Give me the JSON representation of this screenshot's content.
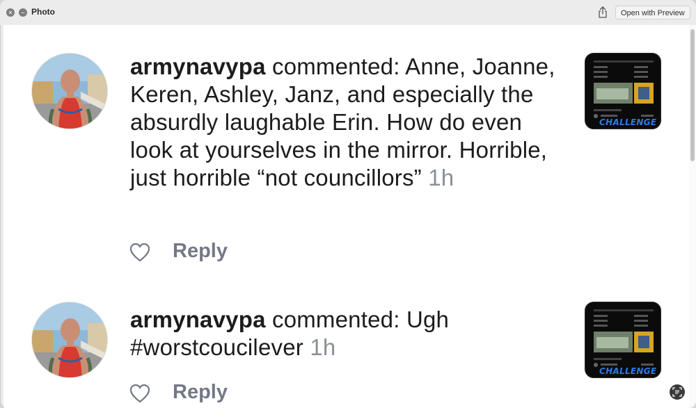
{
  "window": {
    "title": "Photo",
    "open_with_label": "Open with Preview",
    "close_glyph": "×",
    "minimize_glyph": "–",
    "share_icon": "share-icon"
  },
  "comments": [
    {
      "username": "armynavypa",
      "body": " commented: Anne, Joanne, Keren, Ashley, Janz, and especially the absurdly laughable Erin. How do even look at yourselves in the mirror. Horrible, just horrible “not councillors” ",
      "time": "1h",
      "reply_label": "Reply",
      "thumbnail_badge": "CHALLENGE"
    },
    {
      "username": "armynavypa",
      "body": " commented: Ugh #worstcoucilever ",
      "time": "1h",
      "reply_label": "Reply",
      "thumbnail_badge": "CHALLENGE"
    }
  ],
  "colors": {
    "accent_blue": "#2f7be0",
    "muted_gray": "#8a8f98"
  }
}
